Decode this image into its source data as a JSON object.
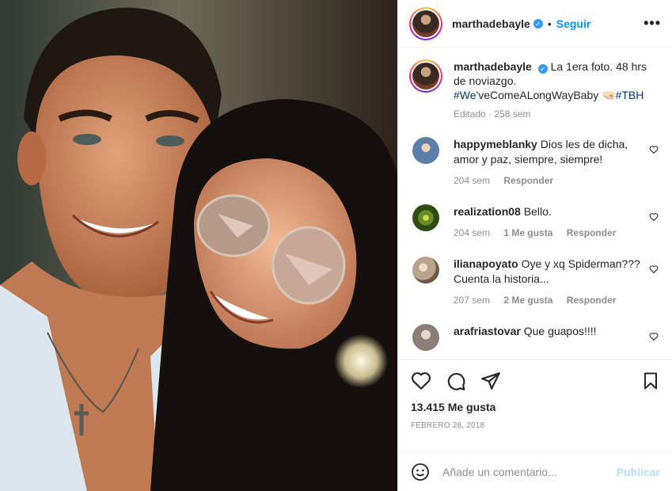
{
  "header": {
    "username": "marthadebayle",
    "dot": "•",
    "follow_label": "Seguir",
    "more_label": "•••"
  },
  "caption": {
    "username": "marthadebayle",
    "text": "La 1era foto. 48 hrs de noviazgo.",
    "hashtag_we": "#We",
    "text_rest": "'veComeALongWayBaby 🤜🏻",
    "hashtag_tbh": "#TBH",
    "meta": "Editado · 258 sem"
  },
  "comments": [
    {
      "username": "happymeblanky",
      "text": "Dios les de dicha, amor y paz, siempre, siempre!",
      "time": "204 sem",
      "likes": "",
      "reply": "Responder",
      "avatar_color": "#5a7fa8"
    },
    {
      "username": "realization08",
      "text": "Bello.",
      "time": "204 sem",
      "likes": "1 Me gusta",
      "reply": "Responder",
      "avatar_color": "#6a8c2a"
    },
    {
      "username": "ilianapoyato",
      "text": "Oye y xq Spiderman??? Cuenta la historia...",
      "time": "207 sem",
      "likes": "2 Me gusta",
      "reply": "Responder",
      "avatar_color": "#b9a38c"
    },
    {
      "username": "arafriastovar",
      "text": "Que guapos!!!!",
      "time": "",
      "likes": "",
      "reply": "",
      "avatar_color": "#8a7e76"
    }
  ],
  "actions": {
    "likes": "13.415 Me gusta",
    "date": "FEBRERO 28, 2018"
  },
  "add_comment": {
    "placeholder": "Añade un comentario...",
    "publish_label": "Publicar"
  }
}
